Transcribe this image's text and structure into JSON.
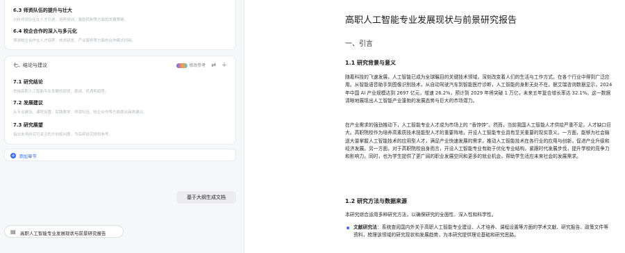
{
  "outline": {
    "items_top": [
      {
        "num": "6.3 师资队伍的提升与壮大",
        "desc": "分析师资队伍在人才引进、培养培训、激励机制等方面的发展策略。"
      },
      {
        "num": "6.4 校企合作的深入与多元化",
        "desc": "预测校企合作在人才培养、技术研发、产业服务等方面的合作模式创新。"
      }
    ],
    "section7": {
      "title": "七、结论与建议",
      "edit_label": "修改参考",
      "items": [
        {
          "num": "7.1 研究结论",
          "desc": "总结高职人工智能专业发展的现状、挑战、机遇和趋势。"
        },
        {
          "num": "7.2 发展建议",
          "desc": "从专业建设、课程设置、实践教学、师资队伍、校企合作等方面提出具体建议。"
        },
        {
          "num": "7.3 研究展望",
          "desc": "指出未来研究可关注的方向和问题，为后续研究提供参考。"
        }
      ]
    },
    "add_chapter_label": "添加章节",
    "generate_button": "基于大纲生成文档",
    "doc_chip_label": "高职人工智能专业发展现状与前景研究报告"
  },
  "document": {
    "title": "高职人工智能专业发展现状与前景研究报告",
    "section1": "一、引言",
    "sub1": "1.1 研究背景与意义",
    "para1": "随着科技的飞速发展，人工智能已成为全球瞩目的关键技术领域，深刻改变着人们的生活与工作方式，在各个行业中得到广泛应用。从智能语音助手到图像识别技术，从自动驾驶汽车到智能医疗诊断，人工智能的身影无处不在。据艾瑞咨询数据显示，2024 年中国 AI 产业规模达到 2697 亿元，增速 26.2%，预计到 2029 年将突破 1 万亿，未来五年复合增长率达 32.1%。这一数据清晰地展现出人工智能产业蓬勃的发展态势与巨大的市场潜力。",
    "para2": "在产业需求的强劲推动下，人工智能专业人才成为市场上的 “香饽饽”。然而，当前我国人工智能人才供给严重不足，人才缺口巨大。高职院校作为培养高素质技术技能型人才的重要阵地，开设人工智能专业具有至关重要的现实意义。一方面，能够为社会输送大量掌握人工智能技术的应用型人才，满足产业快速发展的需求，推动人工智能技术在各行业的应用与创新，促进产业升级和经济发展。另一方面，对于高职院校自身而言，开设人工智能专业有助于优化专业结构，紧跟时代发展步伐，提升学校的竞争力和影响力。同时，也为学生提供了更广阔的职业发展空间和更多的就业机会，帮助学生适应未来社会的发展需求。",
    "sub2": "1.2 研究方法与数据来源",
    "para3": "本研究综合运用多种研究方法，以确保研究的全面性、深入性和科学性。",
    "bullet1_bold": "文献研究法",
    "bullet1_text": "：系统查阅国内外关于高职人工智能专业建设、人才培养、课程设置等方面的学术文献、研究报告、政策文件等资料，梳理该领域的研究现状和发展趋势，为本研究提供理论基础和研究思路。"
  },
  "colors": {
    "accent": "#3b6cf6"
  }
}
